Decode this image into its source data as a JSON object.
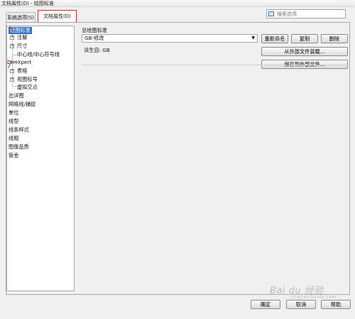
{
  "window": {
    "title": "文档属性(D) - 绘图标准"
  },
  "tabs": [
    {
      "label": "系统选项(S)"
    },
    {
      "label": "文档属性(D)",
      "active": true
    }
  ],
  "search": {
    "placeholder": "搜索选项"
  },
  "tree": {
    "items": [
      {
        "label": "绘图标准",
        "selected": true
      },
      {
        "label": "注解",
        "expandable": true
      },
      {
        "label": "尺寸",
        "expandable": true
      },
      {
        "label": "中心线/中心符号线"
      },
      {
        "label": "DimXpert"
      },
      {
        "label": "表格",
        "expandable": true
      },
      {
        "label": "视图标号",
        "expandable": true
      },
      {
        "label": "虚拟交点"
      },
      {
        "label": "出详图"
      },
      {
        "label": "网格线/捕捉"
      },
      {
        "label": "单位"
      },
      {
        "label": "线型"
      },
      {
        "label": "线条样式"
      },
      {
        "label": "线粗"
      },
      {
        "label": "图像品质"
      },
      {
        "label": "钣金"
      }
    ]
  },
  "standard": {
    "group_label": "总绘图标准",
    "selected_value": "GB-修改",
    "derived_from": "派生自: GB",
    "buttons": {
      "rename": "重新命名",
      "copy": "复制",
      "delete": "删除",
      "load_external": "从外部文件装载...",
      "save_external": "保存到外部文件..."
    }
  },
  "footer": {
    "ok": "确定",
    "cancel": "取消",
    "help": "帮助"
  },
  "watermark": {
    "text": "Bai du 经验",
    "sub": "jingyan.baidu.com"
  },
  "colors": {
    "selection": "#2f6fc6",
    "annotation_red": "#d7262a"
  }
}
